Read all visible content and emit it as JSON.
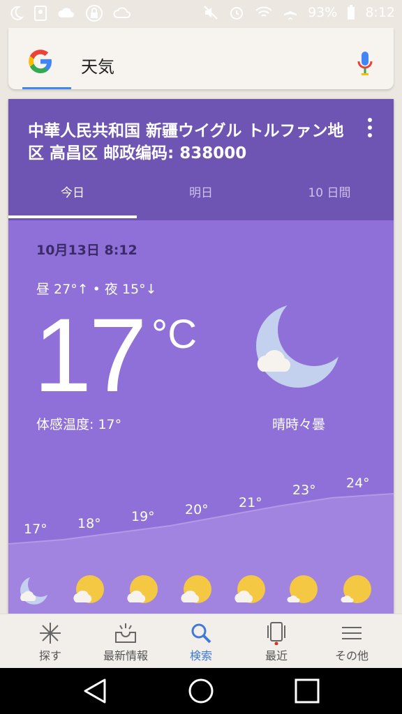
{
  "status_bar": {
    "battery": "93%",
    "time": "8:12"
  },
  "search": {
    "query": "天気"
  },
  "weather": {
    "location": "中華人民共和国 新疆ウイグル トルファン地区 高昌区 邮政编码: 838000",
    "tabs": [
      "今日",
      "明日",
      "10 日間"
    ],
    "active_tab": 0,
    "datetime": "10月13日 8:12",
    "hilo": "昼 27°↑ • 夜 15°↓",
    "temperature": "17",
    "unit": "°C",
    "feels_like": "体感温度: 17°",
    "condition": "晴時々曇",
    "hourly": [
      {
        "temp": "17°",
        "icon": "moon-cloud-icon"
      },
      {
        "temp": "18°",
        "icon": "sun-cloud-icon"
      },
      {
        "temp": "19°",
        "icon": "sun-cloud-icon"
      },
      {
        "temp": "20°",
        "icon": "sun-cloud-icon"
      },
      {
        "temp": "21°",
        "icon": "sun-cloud-icon"
      },
      {
        "temp": "23°",
        "icon": "sun-small-cloud-icon"
      },
      {
        "temp": "24°",
        "icon": "sun-small-cloud-icon"
      }
    ]
  },
  "bottom_nav": {
    "items": [
      {
        "label": "探す",
        "icon": "discover-icon"
      },
      {
        "label": "最新情報",
        "icon": "updates-icon"
      },
      {
        "label": "検索",
        "icon": "search-icon"
      },
      {
        "label": "最近",
        "icon": "recent-icon"
      },
      {
        "label": "その他",
        "icon": "menu-icon"
      }
    ],
    "active": 2
  },
  "colors": {
    "card_header": "#6e55b3",
    "card_body": "#8e70d8",
    "accent": "#4285f4"
  }
}
